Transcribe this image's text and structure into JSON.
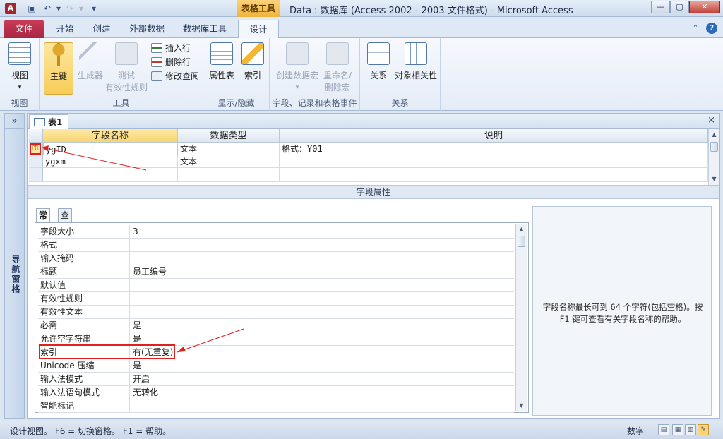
{
  "window": {
    "title": "Data : 数据库 (Access 2002 - 2003 文件格式) - Microsoft Access",
    "context_tab_group": "表格工具",
    "app_icon_text": "A"
  },
  "ribbon_tabs": [
    "文件",
    "开始",
    "创建",
    "外部数据",
    "数据库工具",
    "设计"
  ],
  "ribbon": {
    "view": {
      "label": "视图",
      "group": "视图"
    },
    "tools": {
      "group": "工具",
      "primary_key": "主键",
      "builder": "生成器",
      "test_rules_1": "测试",
      "test_rules_2": "有效性规则",
      "insert_row": "插入行",
      "delete_row": "删除行",
      "modify_lookup": "修改查阅"
    },
    "show_hide": {
      "group": "显示/隐藏",
      "property_sheet": "属性表",
      "indexes": "索引"
    },
    "events": {
      "group": "字段、记录和表格事件",
      "create_macro": "创建数据宏",
      "rename_delete_1": "重命名/",
      "rename_delete_2": "删除宏"
    },
    "relationships": {
      "group": "关系",
      "relationships": "关系",
      "dependencies": "对象相关性"
    }
  },
  "nav_pane": {
    "label": "导航窗格",
    "toggle": "»"
  },
  "document": {
    "tab_label": "表1",
    "close": "×",
    "columns": [
      "字段名称",
      "数据类型",
      "说明"
    ],
    "rows": [
      {
        "name": "ygID",
        "type": "文本",
        "desc": "格式：Y01"
      },
      {
        "name": "ygxm",
        "type": "文本",
        "desc": ""
      }
    ]
  },
  "field_properties": {
    "section_label": "字段属性",
    "tabs": [
      "常规",
      "查阅"
    ],
    "rows": [
      {
        "label": "字段大小",
        "value": "3"
      },
      {
        "label": "格式",
        "value": ""
      },
      {
        "label": "输入掩码",
        "value": ""
      },
      {
        "label": "标题",
        "value": "员工编号"
      },
      {
        "label": "默认值",
        "value": ""
      },
      {
        "label": "有效性规则",
        "value": ""
      },
      {
        "label": "有效性文本",
        "value": ""
      },
      {
        "label": "必需",
        "value": "是"
      },
      {
        "label": "允许空字符串",
        "value": "是"
      },
      {
        "label": "索引",
        "value": "有(无重复)"
      },
      {
        "label": "Unicode 压缩",
        "value": "是"
      },
      {
        "label": "输入法模式",
        "value": "开启"
      },
      {
        "label": "输入法语句模式",
        "value": "无转化"
      },
      {
        "label": "智能标记",
        "value": ""
      }
    ],
    "hint": "字段名称最长可到 64 个字符(包括空格)。按 F1 键可查看有关字段名称的帮助。"
  },
  "statusbar": {
    "left": "设计视图。   F6 = 切换窗格。   F1 = 帮助。",
    "mode": "数字"
  },
  "colors": {
    "accent_file_tab": "#a82743",
    "context_tab": "#f1b43b",
    "annotation_red": "#e01f1f"
  }
}
